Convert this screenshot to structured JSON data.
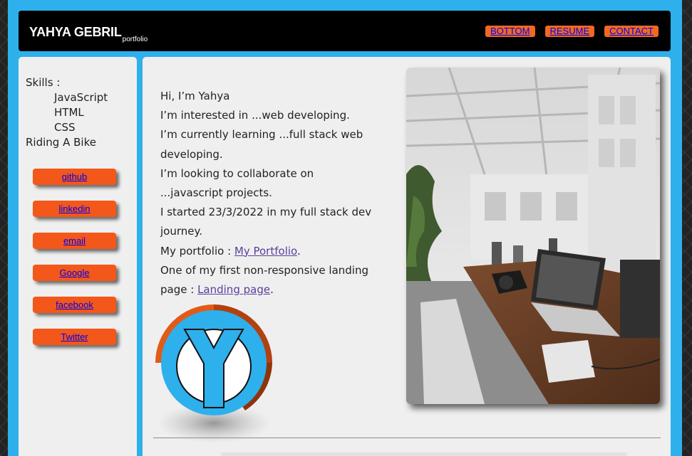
{
  "header": {
    "brand_name": "YAHYA GEBRIL",
    "brand_sub": "portfolio",
    "nav": [
      "BOTTOM",
      "RESUME",
      "CONTACT"
    ]
  },
  "sidebar": {
    "skills_title": "Skills :",
    "skills": [
      "JavaScript",
      "HTML",
      "CSS"
    ],
    "extra": "Riding A Bike",
    "links": [
      "github",
      "linkedin",
      "email",
      "Google",
      "facebook",
      "Twitter"
    ]
  },
  "intro": {
    "line1": "Hi, I’m Yahya",
    "line2": "I’m interested in ...web developing.",
    "line3": "I’m currently learning ...full stack web developing.",
    "line4": "I’m looking to collaborate on ...javascript projects.",
    "line5": "I started 23/3/2022 in my full stack dev journey.",
    "portfolio_prefix": "My portfolio : ",
    "portfolio_link": "My Portfolio",
    "landing_prefix": "One of my first non-responsive landing page : ",
    "landing_link": "Landing page",
    "period": "."
  },
  "colors": {
    "frame": "#2eb0ec",
    "header_bg": "#000000",
    "button": "#f3571a",
    "panel": "#efefef"
  }
}
